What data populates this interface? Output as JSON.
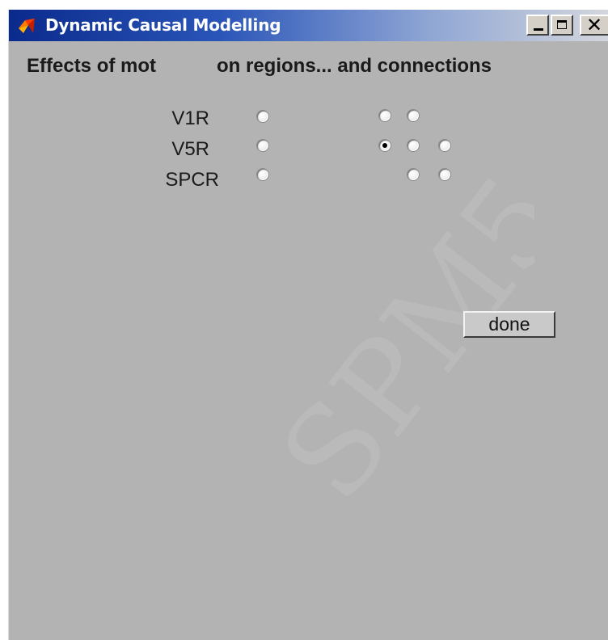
{
  "window": {
    "title": "Dynamic Causal Modelling",
    "controls": {
      "minimize_icon": "minimize-icon",
      "maximize_icon": "maximize-icon",
      "close_icon": "close-icon"
    }
  },
  "header": {
    "effects_label": "Effects of mot",
    "regions_label": "on regions... and connections"
  },
  "regions": [
    {
      "label": "V1R",
      "selected": false
    },
    {
      "label": "V5R",
      "selected": false
    },
    {
      "label": "SPCR",
      "selected": false
    }
  ],
  "connections": [
    [
      false,
      false
    ],
    [
      true,
      false,
      false
    ],
    [
      false,
      false
    ]
  ],
  "done_button": {
    "label": "done"
  },
  "watermark": {
    "text": "SPM5"
  },
  "colors": {
    "panel": "#b3b3b3",
    "titlebar_start": "#0a2a8c",
    "titlebar_end": "#d3d6dd"
  }
}
